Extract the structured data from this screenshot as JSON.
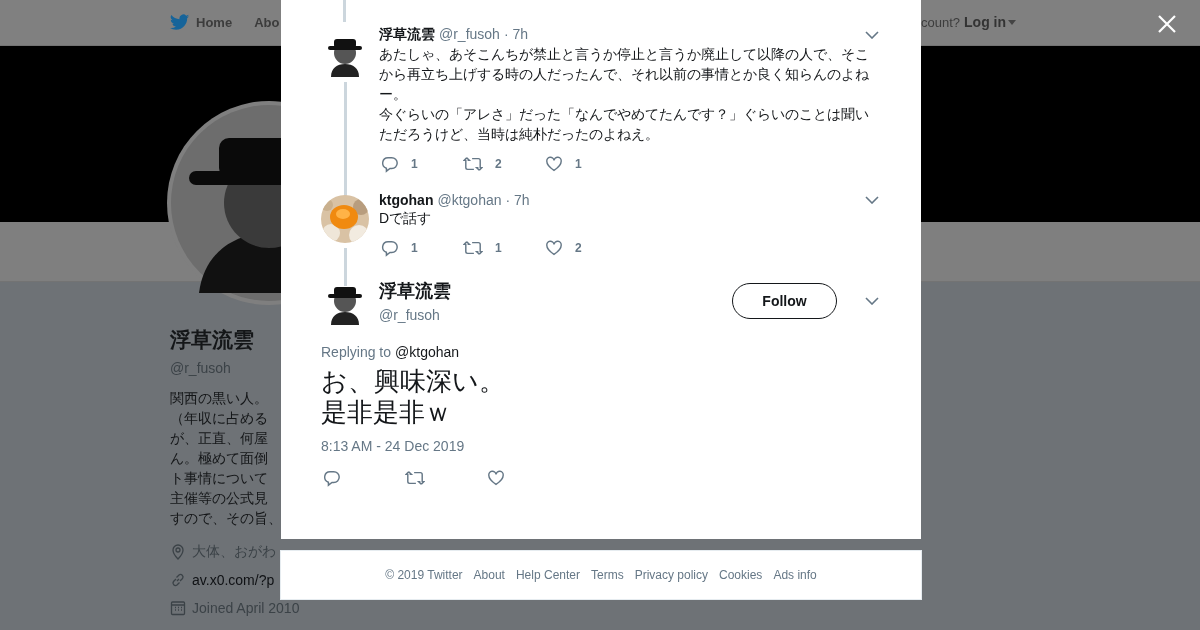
{
  "top_nav": {
    "items": [
      {
        "label": "Home",
        "kind": "home"
      },
      {
        "label": "Abo",
        "kind": "plain"
      }
    ],
    "login_prompt": "count?",
    "login": "Log in"
  },
  "profile": {
    "name": "浮草流雲",
    "handle": "@r_fusoh",
    "bio_lines": [
      "関西の黒い人。",
      "（年収に占める",
      "が、正直、何屋",
      "ん。極めて面倒",
      "ト事情について",
      "主催等の公式見",
      "すので、その旨、"
    ],
    "location": "大体、おがわ",
    "link": "av.x0.com/?p",
    "joined": "Joined April 2010"
  },
  "modal": {
    "thread": [
      {
        "avatar": {
          "kind": "figure"
        },
        "name": "浮草流雲",
        "handle": "@r_fusoh",
        "time": "· 7h",
        "paragraphs": [
          "あたしゃ、あそこんちが禁止と言うか停止と言うか廃止して以降の人で、そこから再立ち上げする時の人だったんで、それ以前の事情とか良く知らんのよねー。",
          "今ぐらいの「アレさ」だった「なんでやめてたんです？」ぐらいのことは聞いただろうけど、当時は純朴だったのよねえ。"
        ],
        "actions": [
          {
            "kind": "reply",
            "count": "1"
          },
          {
            "kind": "retweet",
            "count": "2"
          },
          {
            "kind": "like",
            "count": "1"
          }
        ]
      },
      {
        "avatar": {
          "kind": "picture"
        },
        "name": "ktgohan",
        "handle": "@ktgohan",
        "time": "· 7h",
        "paragraphs": [
          "Dで話す"
        ],
        "actions": [
          {
            "kind": "reply",
            "count": "1"
          },
          {
            "kind": "retweet",
            "count": "1"
          },
          {
            "kind": "like",
            "count": "2"
          }
        ]
      }
    ],
    "main_tweet": {
      "avatar": {
        "kind": "figure"
      },
      "name": "浮草流雲",
      "handle": "@r_fusoh",
      "follow": "Follow",
      "replying_label": "Replying to",
      "replying_to": "@ktgohan",
      "paragraphs": [
        "お、興味深い。",
        "是非是非ｗ"
      ],
      "timestamp": "8:13 AM - 24 Dec 2019",
      "actions": [
        {
          "kind": "reply"
        },
        {
          "kind": "retweet"
        },
        {
          "kind": "like"
        }
      ]
    }
  },
  "footer": [
    "© 2019 Twitter",
    "About",
    "Help Center",
    "Terms",
    "Privacy policy",
    "Cookies",
    "Ads info"
  ]
}
